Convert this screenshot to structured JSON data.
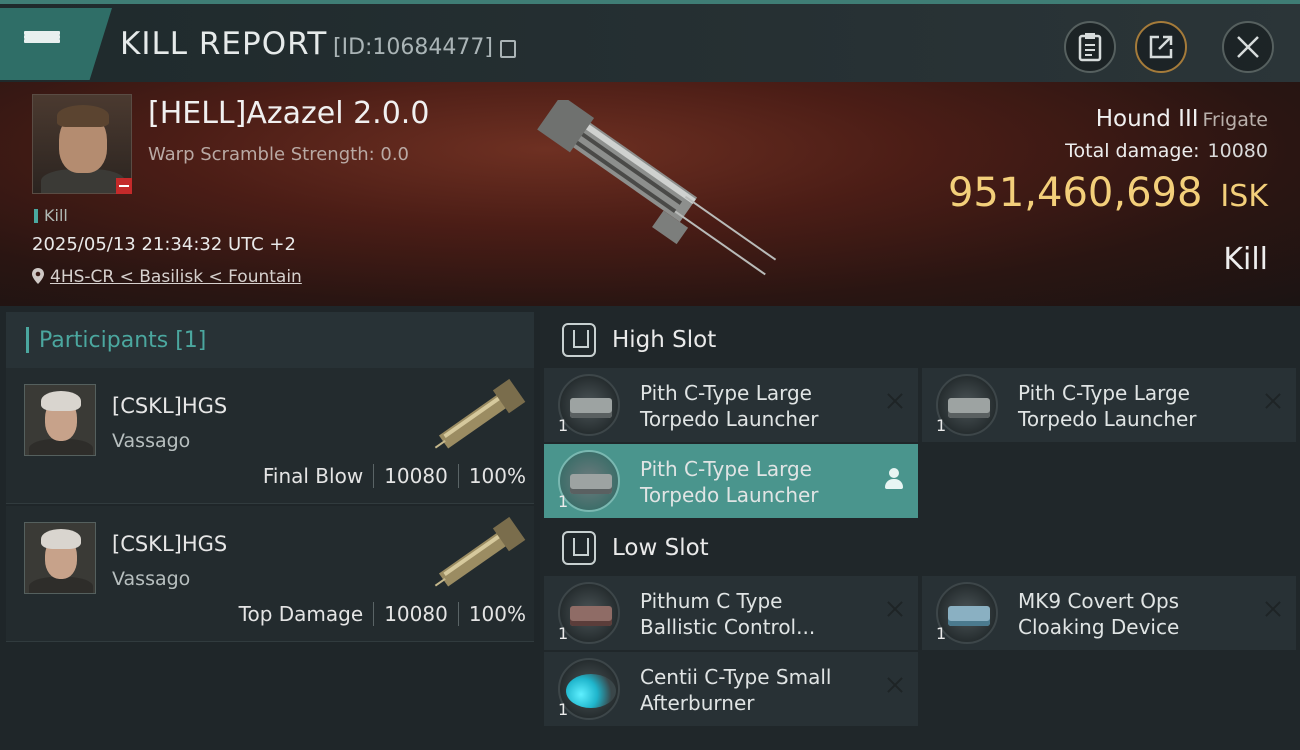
{
  "header": {
    "title": "KILL REPORT",
    "kill_id": "[ID:10684477]"
  },
  "victim": {
    "name": "[HELL]Azazel 2.0.0",
    "warp_scramble": "Warp Scramble Strength: 0.0",
    "kill_tag": "Kill",
    "datetime": "2025/05/13 21:34:32 UTC +2",
    "location": "4HS-CR < Basilisk < Fountain",
    "ship_name": "Hound III",
    "ship_class": "Frigate",
    "total_damage_label": "Total damage:",
    "total_damage": "10080",
    "isk_value": "951,460,698",
    "isk_unit": "ISK",
    "kill_type": "Kill"
  },
  "participants": {
    "title": "Participants [1]",
    "rows": [
      {
        "corp": "[CSKL]HGS",
        "ship": "Vassago",
        "role": "Final Blow",
        "damage": "10080",
        "percent": "100%"
      },
      {
        "corp": "[CSKL]HGS",
        "ship": "Vassago",
        "role": "Top Damage",
        "damage": "10080",
        "percent": "100%"
      }
    ]
  },
  "slots": {
    "high": {
      "label": "High Slot",
      "items": [
        {
          "name_line1": "Pith C-Type Large",
          "name_line2": "Torpedo Launcher",
          "qty": "1"
        },
        {
          "name_line1": "Pith C-Type Large",
          "name_line2": "Torpedo Launcher",
          "qty": "1"
        },
        {
          "name_line1": "Pith C-Type Large",
          "name_line2": "Torpedo Launcher",
          "qty": "1"
        }
      ]
    },
    "low": {
      "label": "Low Slot",
      "items": [
        {
          "name_line1": "Pithum C  Type",
          "name_line2": "Ballistic Control...",
          "qty": "1"
        },
        {
          "name_line1": "MK9 Covert Ops",
          "name_line2": "Cloaking Device",
          "qty": "1"
        },
        {
          "name_line1": "Centii C-Type Small",
          "name_line2": "Afterburner",
          "qty": "1"
        }
      ]
    }
  },
  "colors": {
    "accent": "#4a958d",
    "isk": "#f3cf7a",
    "banner": "#4b1d16"
  }
}
